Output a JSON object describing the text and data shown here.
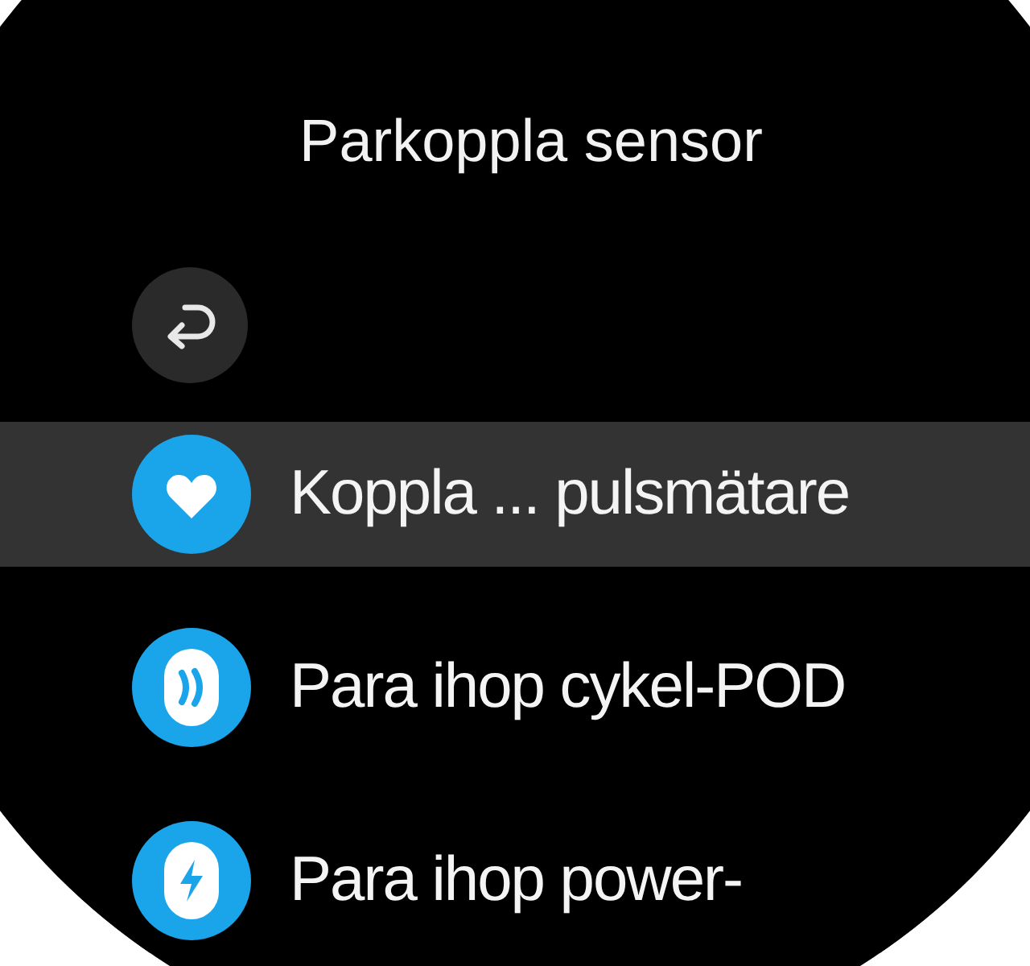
{
  "title": "Parkoppla sensor",
  "items": [
    {
      "kind": "heart",
      "label": "Koppla ... pulsmätare",
      "selected": true
    },
    {
      "kind": "pod",
      "label": "Para ihop cykel-POD",
      "selected": false
    },
    {
      "kind": "power",
      "label": "Para ihop power-",
      "selected": false
    }
  ]
}
